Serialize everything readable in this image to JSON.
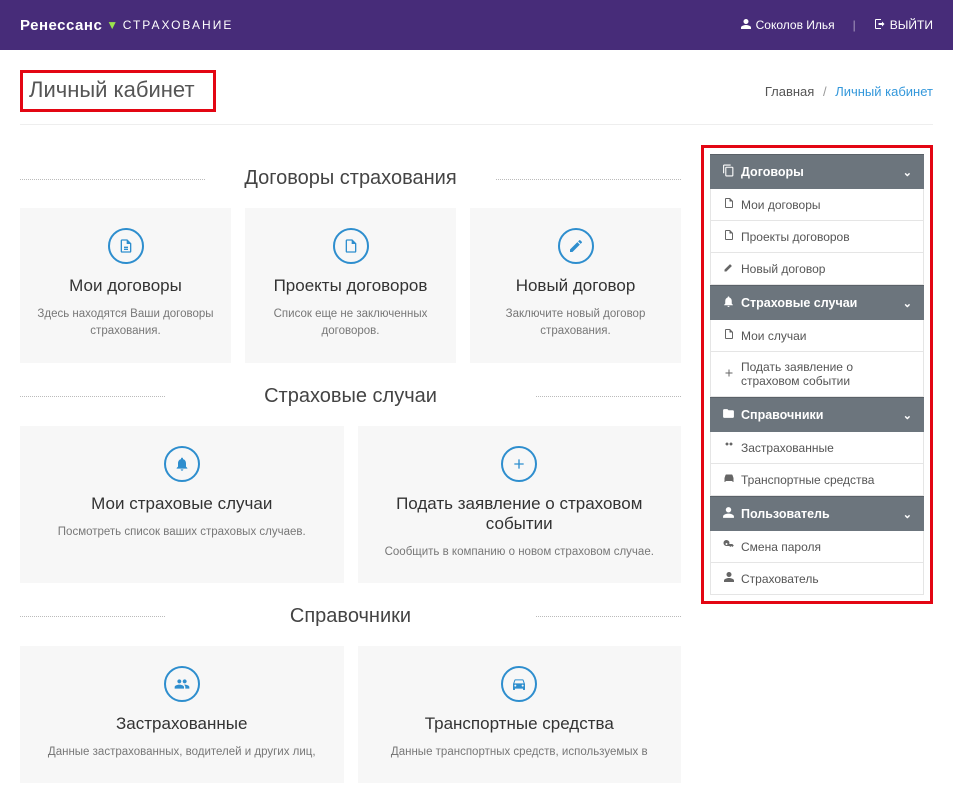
{
  "header": {
    "brand": "Ренессанс",
    "subbrand": "СТРАХОВАНИЕ",
    "user": "Соколов Илья",
    "logout": "ВЫЙТИ"
  },
  "page": {
    "title": "Личный кабинет"
  },
  "breadcrumb": {
    "root": "Главная",
    "current": "Личный кабинет"
  },
  "sections": {
    "contracts": {
      "title": "Договоры страхования",
      "cards": [
        {
          "title": "Мои договоры",
          "desc": "Здесь находятся Ваши договоры страхования."
        },
        {
          "title": "Проекты договоров",
          "desc": "Список еще не заключенных договоров."
        },
        {
          "title": "Новый договор",
          "desc": "Заключите новый договор страхования."
        }
      ]
    },
    "cases": {
      "title": "Страховые случаи",
      "cards": [
        {
          "title": "Мои страховые случаи",
          "desc": "Посмотреть список ваших страховых случаев."
        },
        {
          "title": "Подать заявление о страховом событии",
          "desc": "Сообщить в компанию о новом страховом случае."
        }
      ]
    },
    "refs": {
      "title": "Справочники",
      "cards": [
        {
          "title": "Застрахованные",
          "desc": "Данные застрахованных, водителей и других лиц,"
        },
        {
          "title": "Транспортные средства",
          "desc": "Данные транспортных средств, используемых в"
        }
      ]
    }
  },
  "sidebar": {
    "groups": [
      {
        "label": "Договоры",
        "items": [
          "Мои договоры",
          "Проекты договоров",
          "Новый договор"
        ]
      },
      {
        "label": "Страховые случаи",
        "items": [
          "Мои случаи",
          "Подать заявление о страховом событии"
        ]
      },
      {
        "label": "Справочники",
        "items": [
          "Застрахованные",
          "Транспортные средства"
        ]
      },
      {
        "label": "Пользователь",
        "items": [
          "Смена пароля",
          "Страхователь"
        ]
      }
    ]
  }
}
